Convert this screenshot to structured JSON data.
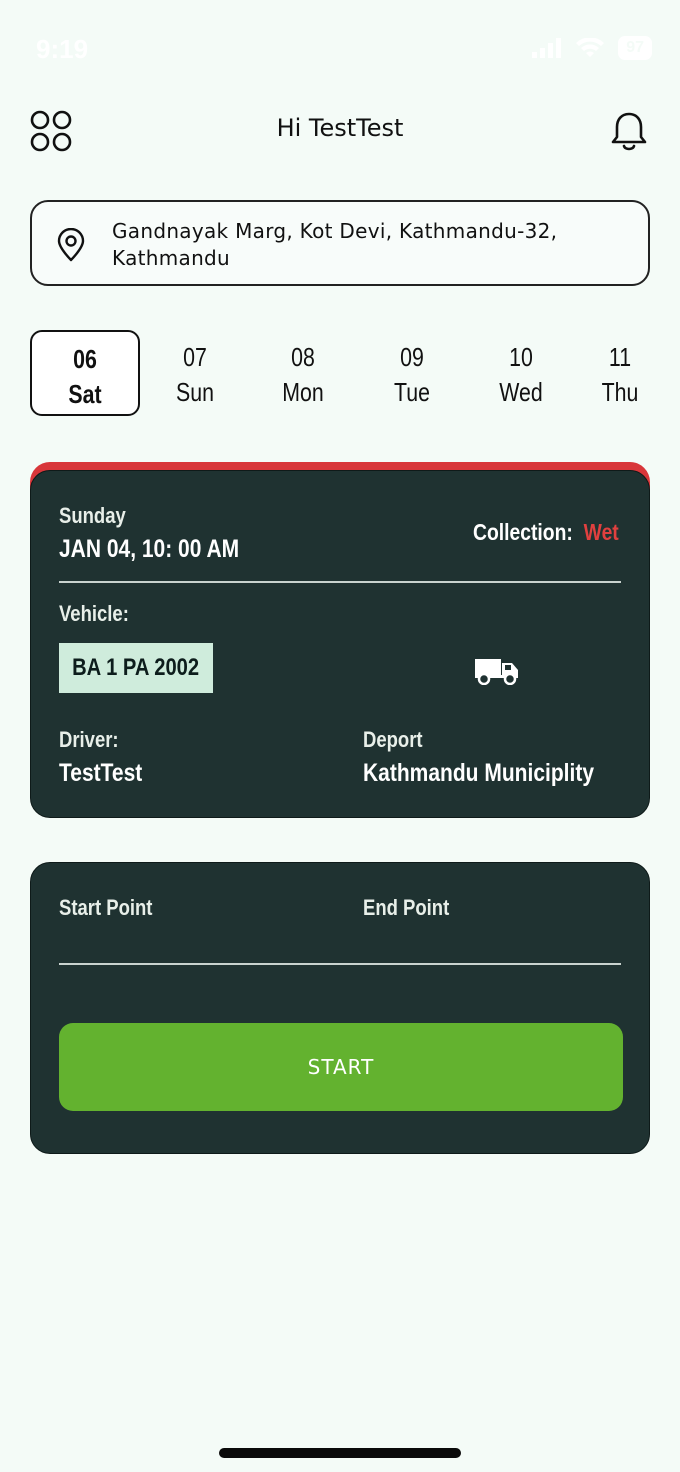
{
  "status_bar": {
    "time": "9:19",
    "battery": "97"
  },
  "header": {
    "greeting": "Hi TestTest"
  },
  "location": {
    "address": "Gandnayak Marg, Kot Devi, Kathmandu-32, Kathmandu"
  },
  "dates": [
    {
      "num": "06",
      "day": "Sat",
      "selected": true
    },
    {
      "num": "07",
      "day": "Sun"
    },
    {
      "num": "08",
      "day": "Mon"
    },
    {
      "num": "09",
      "day": "Tue"
    },
    {
      "num": "10",
      "day": "Wed"
    },
    {
      "num": "11",
      "day": "Thu"
    }
  ],
  "schedule_card": {
    "weekday": "Sunday",
    "datetime": "JAN 04, 10: 00 AM",
    "collection_label": "Collection:",
    "collection_value": "Wet",
    "vehicle_label": "Vehicle:",
    "plate": "BA 1 PA 2002",
    "driver_label": "Driver:",
    "driver_name": "TestTest",
    "deport_label": "Deport",
    "deport_name": "Kathmandu Municiplity"
  },
  "route_card": {
    "start_label": "Start Point",
    "end_label": "End Point",
    "start_button": "START"
  },
  "colors": {
    "card_bg": "#1f3231",
    "accent_red": "#d8363a",
    "button_green": "#63b22f",
    "plate_bg": "#cfecdc",
    "page_bg": "#f4fbf7"
  }
}
